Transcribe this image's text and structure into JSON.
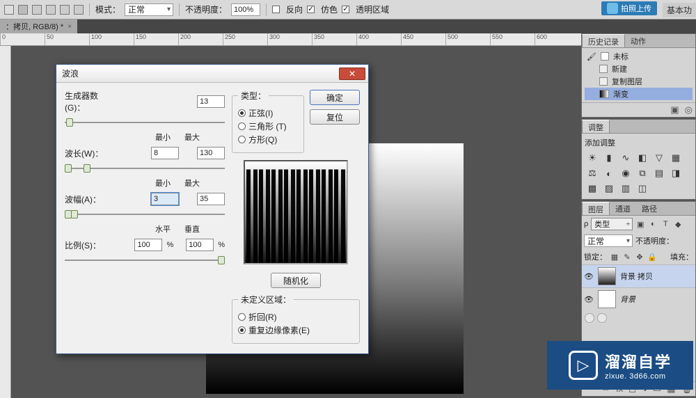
{
  "optbar": {
    "mode_label": "模式：",
    "mode_value": "正常",
    "opacity_label": "不透明度：",
    "opacity_value": "100%",
    "reverse_label": "反向",
    "dither_label": "仿色",
    "transparency_label": "透明区域",
    "upload_label": "拍照上传",
    "basic_label": "基本功"
  },
  "doctab": {
    "title": "：拷贝, RGB/8) *"
  },
  "ruler_marks": [
    "0",
    "50",
    "100",
    "150",
    "200",
    "250",
    "300",
    "350",
    "400",
    "450",
    "500",
    "550",
    "600"
  ],
  "history_panel": {
    "tab_history": "历史记录",
    "tab_actions": "动作",
    "item_untitled": "未标",
    "items": [
      "新建",
      "复制图层",
      "渐变"
    ]
  },
  "adjust_panel": {
    "tab": "调整",
    "heading": "添加调整"
  },
  "layers_panel": {
    "tab_layers": "图层",
    "tab_channels": "通道",
    "tab_paths": "路径",
    "kind_label": "类型",
    "blend_mode": "正常",
    "opacity_label": "不透明度：",
    "lock_label": "锁定：",
    "fill_label": "填充：",
    "layer0": "背景 拷贝",
    "layer1": "背景"
  },
  "watermark": {
    "cn": "溜溜自学",
    "url": "zixue. 3d66.com"
  },
  "dialog": {
    "title": "波浪",
    "generators_label": "生成器数(G)：",
    "generators_value": "13",
    "min_label": "最小",
    "max_label": "最大",
    "wavelength_label": "波长(W)：",
    "wavelength_min": "8",
    "wavelength_max": "130",
    "amplitude_label": "波幅(A)：",
    "amplitude_min": "3",
    "amplitude_max": "35",
    "horiz_label": "水平",
    "vert_label": "垂直",
    "scale_label": "比例(S)：",
    "scale_h": "100",
    "scale_v": "100",
    "pct": "%",
    "type_legend": "类型：",
    "type_sine": "正弦(I)",
    "type_triangle": "三角形 (T)",
    "type_square": "方形(Q)",
    "ok": "确定",
    "reset": "复位",
    "randomize": "随机化",
    "undef_legend": "未定义区域：",
    "undef_wrap": "折回(R)",
    "undef_repeat": "重复边缘像素(E)"
  }
}
